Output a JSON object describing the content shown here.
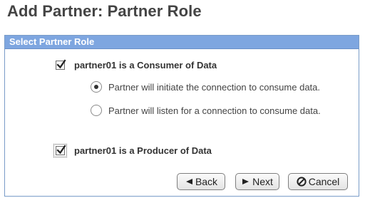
{
  "title": "Add Partner: Partner Role",
  "panel": {
    "header": "Select Partner Role",
    "consumer": {
      "label": "partner01 is a Consumer of Data",
      "checked": true,
      "options": [
        {
          "label": "Partner will initiate the connection to consume data.",
          "selected": true
        },
        {
          "label": "Partner will listen for a connection to consume data.",
          "selected": false
        }
      ]
    },
    "producer": {
      "label": "partner01 is a Producer of Data",
      "checked": true
    }
  },
  "buttons": {
    "back": {
      "label": "Back",
      "icon": "chevron-left-icon"
    },
    "next": {
      "label": "Next",
      "icon": "chevron-right-icon"
    },
    "cancel": {
      "label": "Cancel",
      "icon": "cancel-icon"
    }
  },
  "colors": {
    "header_bg": "#7ea6e0",
    "panel_border": "#7a9cc8",
    "title_text": "#444444"
  }
}
